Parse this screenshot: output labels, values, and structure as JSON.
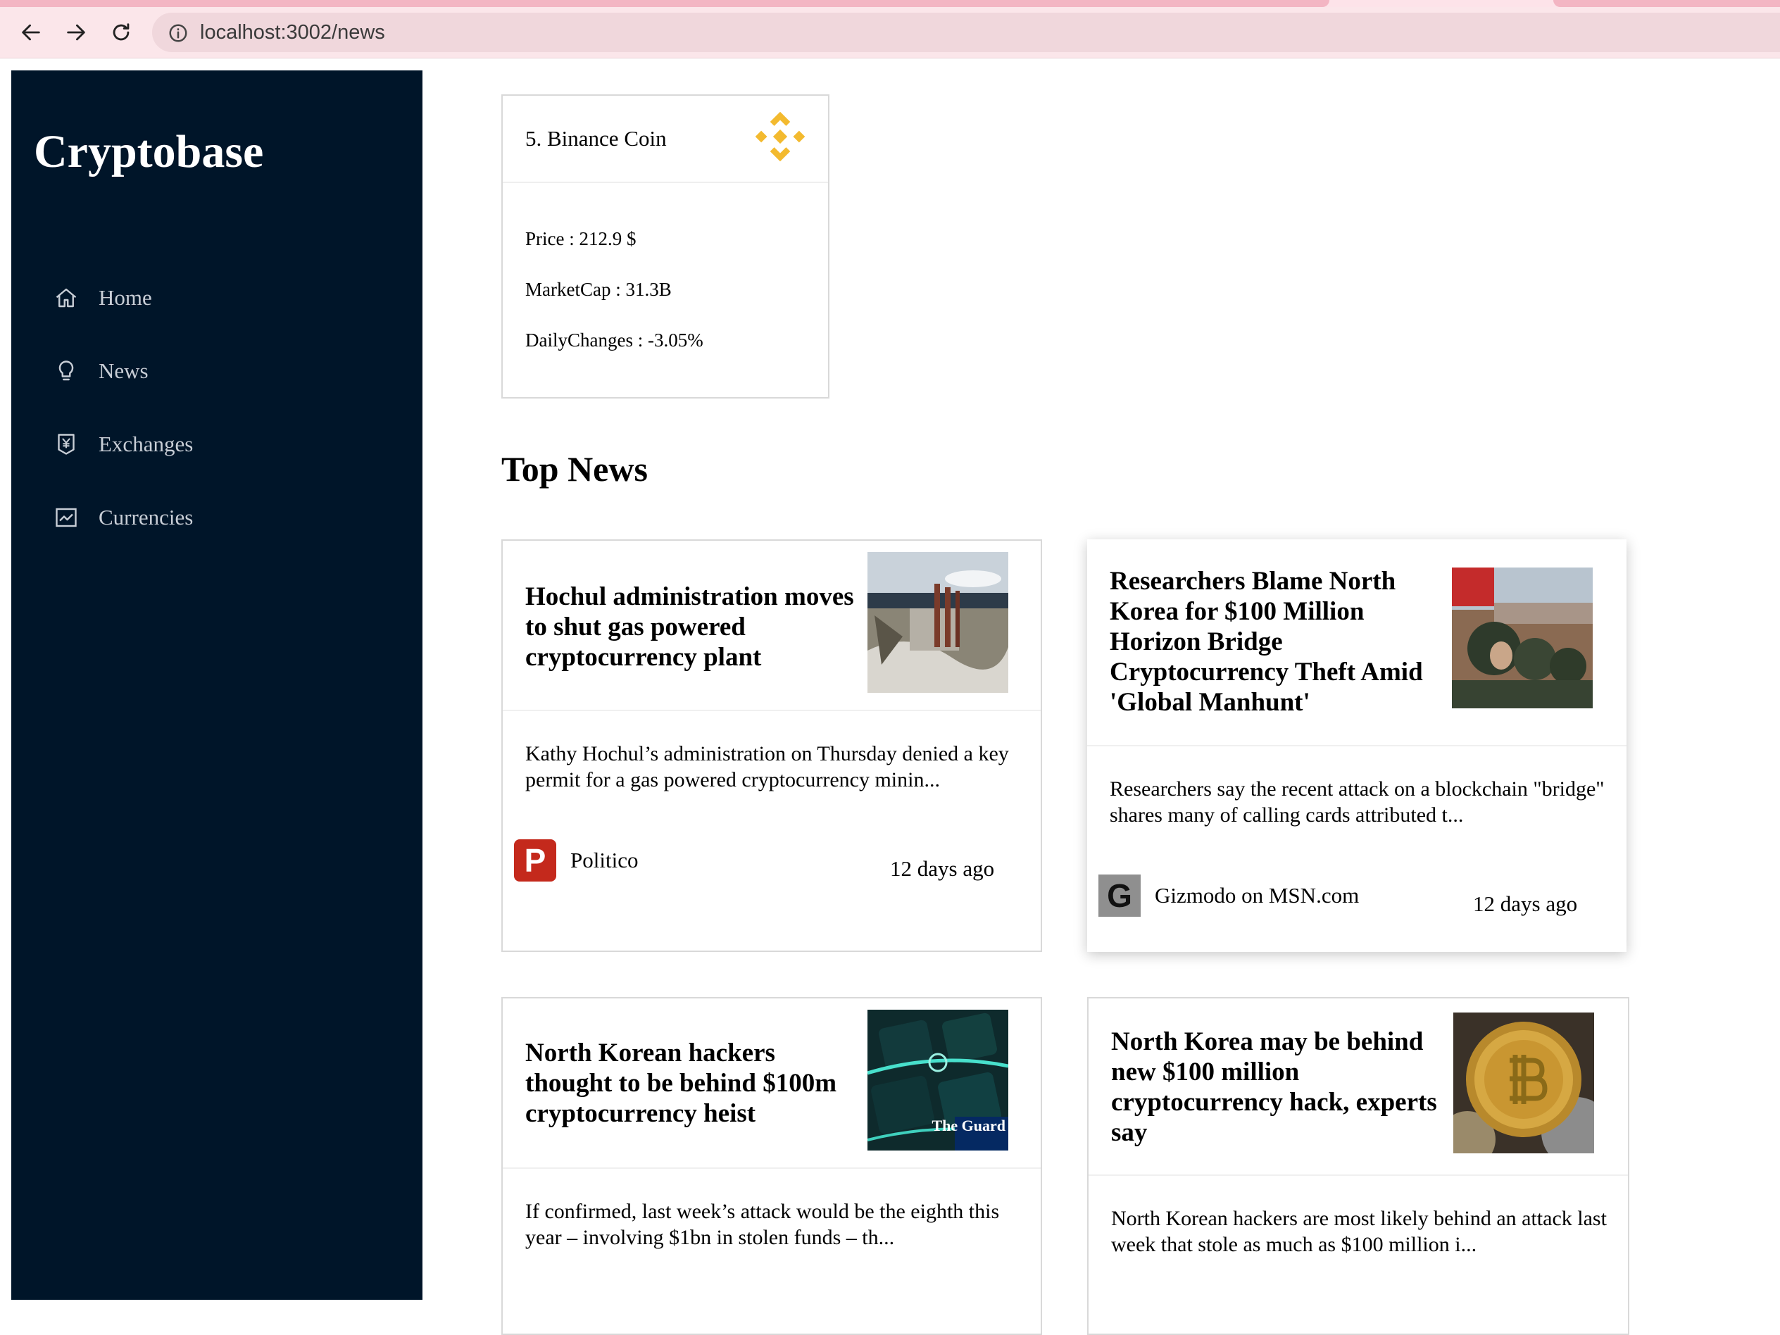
{
  "browser": {
    "url": "localhost:3002/news"
  },
  "sidebar": {
    "brand": "Cryptobase",
    "items": [
      {
        "label": "Home",
        "icon": "home-icon"
      },
      {
        "label": "News",
        "icon": "bulb-icon"
      },
      {
        "label": "Exchanges",
        "icon": "money-collect-icon"
      },
      {
        "label": "Currencies",
        "icon": "fund-icon"
      }
    ]
  },
  "coin": {
    "title": "5. Binance Coin",
    "price": "Price : 212.9 $",
    "market_cap": "MarketCap : 31.3B",
    "daily_change": "DailyChanges : -3.05%"
  },
  "section": {
    "title": "Top News"
  },
  "news": [
    {
      "title": "Hochul administration moves to shut gas powered cryptocurrency plant",
      "description": "Kathy Hochul’s administration on Thursday denied a key permit for a gas powered cryptocurrency minin...",
      "provider": "Politico",
      "provider_letter": "P",
      "time": "12 days ago"
    },
    {
      "title": "Researchers Blame North Korea for $100 Million Horizon Bridge Cryptocurrency Theft Amid 'Global Manhunt'",
      "description": "Researchers say the recent attack on a blockchain \"bridge\" shares many of calling cards attributed t...",
      "provider": "Gizmodo on MSN.com",
      "provider_letter": "G",
      "time": "12 days ago"
    },
    {
      "title": "North Korean hackers thought to be behind $100m cryptocurrency heist",
      "description": "If confirmed, last week’s attack would be the eighth this year – involving $1bn in stolen funds – th...",
      "thumb_badge": "The Guard"
    },
    {
      "title": "North Korea may be behind new $100 million cryptocurrency hack, experts say",
      "description": "North Korean hackers are most likely behind an attack last week that stole as much as $100 million i..."
    }
  ],
  "colors": {
    "sidebar_bg": "#001529",
    "binance_gold": "#F3BA2F",
    "politico_red": "#C4291C"
  }
}
